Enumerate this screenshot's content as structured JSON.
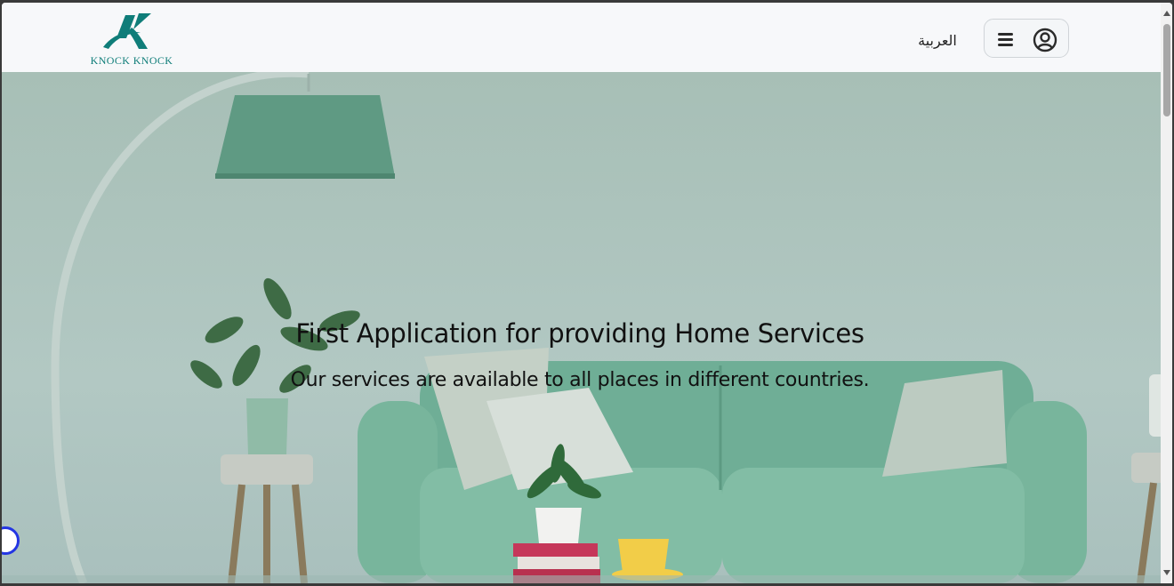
{
  "header": {
    "logo_text": "KNOCK KNOCK",
    "language_link": "العربية"
  },
  "hero": {
    "title": "First Application for providing Home Services",
    "subtitle": "Our services are available to all places in different countries."
  },
  "icons": {
    "menu": "hamburger-icon",
    "account": "user-circle-icon",
    "chat": "chat-bubble-icon"
  },
  "colors": {
    "brand": "#0f7d79",
    "sofa": "#7db8a2",
    "wall": "#a9c1bb",
    "chat_widget": "#2335e3"
  }
}
